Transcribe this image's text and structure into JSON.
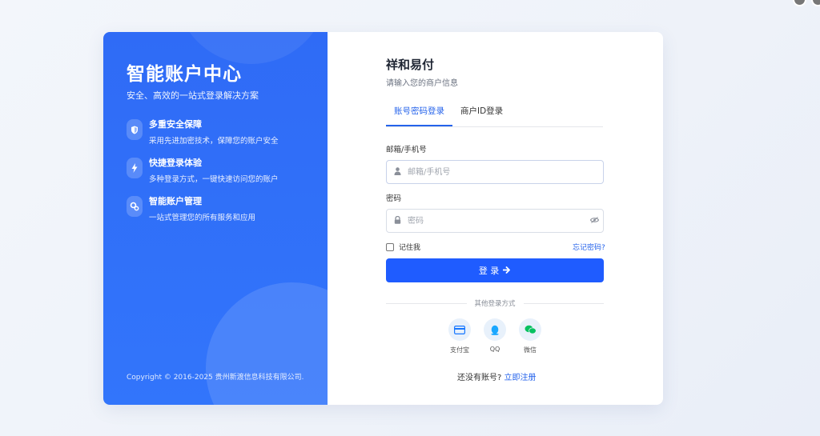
{
  "left": {
    "title": "智能账户中心",
    "subtitle": "安全、高效的一站式登录解决方案",
    "features": [
      {
        "name": "多重安全保障",
        "desc": "采用先进加密技术，保障您的账户安全",
        "icon": "shield-icon"
      },
      {
        "name": "快捷登录体验",
        "desc": "多种登录方式，一键快速访问您的账户",
        "icon": "bolt-icon"
      },
      {
        "name": "智能账户管理",
        "desc": "一站式管理您的所有服务和应用",
        "icon": "gears-icon"
      }
    ],
    "copyright": "Copyright © 2016-2025 贵州新渡信息科技有限公司."
  },
  "right": {
    "brand": "祥和易付",
    "subtitle": "请输入您的商户信息",
    "tabs": [
      {
        "label": "账号密码登录",
        "active": true
      },
      {
        "label": "商户ID登录",
        "active": false
      }
    ],
    "email": {
      "label": "邮箱/手机号",
      "placeholder": "邮箱/手机号",
      "value": ""
    },
    "password": {
      "label": "密码",
      "placeholder": "密码",
      "value": ""
    },
    "remember_label": "记住我",
    "forgot_label": "忘记密码?",
    "login_label": "登 录",
    "other_login": "其他登录方式",
    "socials": [
      {
        "label": "支付宝",
        "icon": "card-icon",
        "color": "#1677ff"
      },
      {
        "label": "QQ",
        "icon": "qq-penguin-icon",
        "color": "#1aa7ff"
      },
      {
        "label": "微信",
        "icon": "wechat-icon",
        "color": "#07c160"
      }
    ],
    "register_prompt": "还没有账号?",
    "register_link": "立即注册"
  },
  "colors": {
    "accent": "#1f5cff",
    "panel": "#2f6bf6",
    "link": "#2563eb"
  }
}
